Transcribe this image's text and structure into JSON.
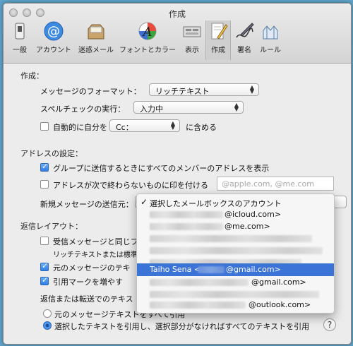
{
  "window": {
    "title": "作成"
  },
  "toolbar": {
    "items": [
      {
        "label": "一般",
        "icon": "switch-icon"
      },
      {
        "label": "アカウント",
        "icon": "at-icon"
      },
      {
        "label": "迷惑メール",
        "icon": "junk-mail-icon"
      },
      {
        "label": "フォントとカラー",
        "icon": "font-color-icon"
      },
      {
        "label": "表示",
        "icon": "view-icon"
      },
      {
        "label": "作成",
        "icon": "compose-icon"
      },
      {
        "label": "署名",
        "icon": "signature-icon"
      },
      {
        "label": "ルール",
        "icon": "rules-icon"
      }
    ],
    "active_index": 5
  },
  "compose": {
    "heading": "作成：",
    "format_label": "メッセージのフォーマット：",
    "format_value": "リッチテキスト",
    "spellcheck_label": "スペルチェックの実行：",
    "spellcheck_value": "入力中",
    "auto_cc_label": "自動的に自分を",
    "auto_cc_value": "Cc：",
    "auto_cc_suffix": "に含める",
    "auto_cc_checked": false
  },
  "addressing": {
    "heading": "アドレスの設定：",
    "group_label": "グループに送信するときにすべてのメンバーのアドレスを表示",
    "group_checked": true,
    "mark_label": "アドレスが次で終わらないものに印を付ける",
    "mark_checked": false,
    "mark_placeholder": "@apple.com, @me.com",
    "send_from_label": "新規メッセージの送信元："
  },
  "send_from_menu": {
    "items": [
      {
        "text": "選択したメールボックスのアカウント",
        "checked": true,
        "highlighted": false
      },
      {
        "text": "@icloud.com>",
        "checked": false,
        "highlighted": false
      },
      {
        "text": "@me.com>",
        "checked": false,
        "highlighted": false
      },
      {
        "text": "",
        "checked": false,
        "highlighted": false
      },
      {
        "text": "",
        "checked": false,
        "highlighted": false
      },
      {
        "text": "",
        "checked": false,
        "highlighted": false
      },
      {
        "text": "Taiho Sena <",
        "suffix": "@gmail.com>",
        "checked": false,
        "highlighted": true
      },
      {
        "text": "@gmail.com>",
        "checked": false,
        "highlighted": false
      },
      {
        "text": "",
        "checked": false,
        "highlighted": false
      },
      {
        "text": "@outlook.com>",
        "checked": false,
        "highlighted": false
      }
    ]
  },
  "reply": {
    "heading": "返信レイアウト：",
    "match_label": "受信メッセージと同じフ",
    "match_checked": false,
    "match_note": "リッチテキストまたは標準",
    "quote_label": "元のメッセージのテキ",
    "quote_checked": true,
    "increase_label": "引用マークを増やす",
    "increase_checked": true,
    "forward_label": "返信または転送でのテキス",
    "all_text_label": "元のメッセージテキストをすべて引用",
    "all_text_selected": false,
    "selected_text_label": "選択したテキストを引用し、選択部分がなければすべてのテキストを引用",
    "selected_text_selected": true
  },
  "help_label": "?"
}
